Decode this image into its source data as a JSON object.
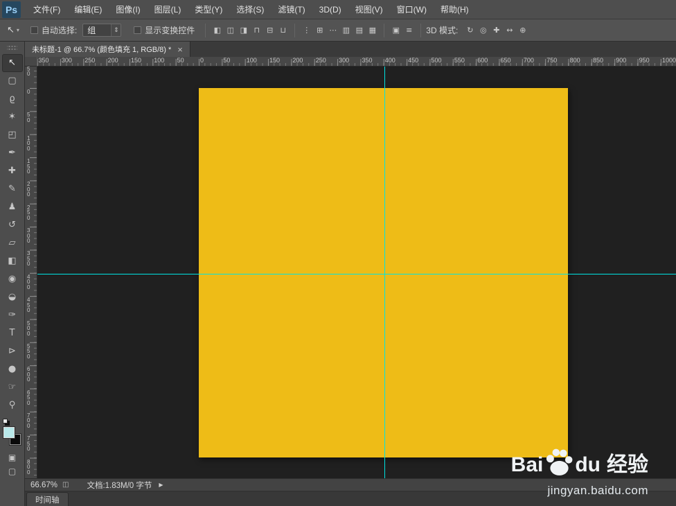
{
  "menu_bar": {
    "logo": "Ps",
    "items": [
      {
        "label": "文件(F)"
      },
      {
        "label": "编辑(E)"
      },
      {
        "label": "图像(I)"
      },
      {
        "label": "图层(L)"
      },
      {
        "label": "类型(Y)"
      },
      {
        "label": "选择(S)"
      },
      {
        "label": "滤镜(T)"
      },
      {
        "label": "3D(D)"
      },
      {
        "label": "视图(V)"
      },
      {
        "label": "窗口(W)"
      },
      {
        "label": "帮助(H)"
      }
    ]
  },
  "options_bar": {
    "tool_icon": "↖",
    "dropdown_arrow": "▾",
    "auto_select_label": "自动选择:",
    "group_value": "组",
    "stepper_glyph": "⇕",
    "show_transform_label": "显示变换控件",
    "align_icons": [
      {
        "name": "align-left-edges-icon",
        "glyph": "◧"
      },
      {
        "name": "align-horizontal-centers-icon",
        "glyph": "◫"
      },
      {
        "name": "align-right-edges-icon",
        "glyph": "◨"
      },
      {
        "name": "align-top-edges-icon",
        "glyph": "⊓"
      },
      {
        "name": "align-vertical-centers-icon",
        "glyph": "⊟"
      },
      {
        "name": "align-bottom-edges-icon",
        "glyph": "⊔"
      }
    ],
    "distribute_icons": [
      {
        "name": "distribute-top-edges-icon",
        "glyph": "⋮"
      },
      {
        "name": "distribute-vertical-centers-icon",
        "glyph": "⊞"
      },
      {
        "name": "distribute-bottom-edges-icon",
        "glyph": "⋯"
      },
      {
        "name": "distribute-left-edges-icon",
        "glyph": "▥"
      },
      {
        "name": "distribute-horizontal-centers-icon",
        "glyph": "▤"
      },
      {
        "name": "distribute-right-edges-icon",
        "glyph": "▦"
      }
    ],
    "extra_icons": [
      {
        "name": "auto-align-layers-icon",
        "glyph": "▣"
      },
      {
        "name": "arrange-icon",
        "glyph": "≡"
      }
    ],
    "mode_3d_label": "3D 模式:",
    "mode_3d_icons": [
      {
        "name": "3d-rotate-icon",
        "glyph": "↻"
      },
      {
        "name": "3d-roll-icon",
        "glyph": "◎"
      },
      {
        "name": "3d-drag-icon",
        "glyph": "✚"
      },
      {
        "name": "3d-slide-icon",
        "glyph": "↔"
      },
      {
        "name": "3d-scale-icon",
        "glyph": "⊕"
      }
    ]
  },
  "document_tab": {
    "title": "未标题-1 @ 66.7% (颜色填充 1, RGB/8) *",
    "close_glyph": "×"
  },
  "tools": [
    {
      "name": "move-tool",
      "glyph": "↖"
    },
    {
      "name": "rectangular-marquee-tool",
      "glyph": "▢"
    },
    {
      "name": "lasso-tool",
      "glyph": "ϱ"
    },
    {
      "name": "quick-selection-tool",
      "glyph": "✶"
    },
    {
      "name": "crop-tool",
      "glyph": "◰"
    },
    {
      "name": "eyedropper-tool",
      "glyph": "✒"
    },
    {
      "name": "healing-brush-tool",
      "glyph": "✚"
    },
    {
      "name": "brush-tool",
      "glyph": "✎"
    },
    {
      "name": "clone-stamp-tool",
      "glyph": "♟"
    },
    {
      "name": "history-brush-tool",
      "glyph": "↺"
    },
    {
      "name": "eraser-tool",
      "glyph": "▱"
    },
    {
      "name": "gradient-tool",
      "glyph": "◧"
    },
    {
      "name": "blur-tool",
      "glyph": "◉"
    },
    {
      "name": "dodge-tool",
      "glyph": "◒"
    },
    {
      "name": "pen-tool",
      "glyph": "✑"
    },
    {
      "name": "type-tool",
      "glyph": "T"
    },
    {
      "name": "path-selection-tool",
      "glyph": "⊳"
    },
    {
      "name": "shape-tool",
      "glyph": "●"
    },
    {
      "name": "hand-tool",
      "glyph": "☞"
    },
    {
      "name": "zoom-tool",
      "glyph": "⚲"
    }
  ],
  "tool_colors": {
    "foreground": "#b9e9ea",
    "background": "#0a0a0a"
  },
  "tool_footer": [
    {
      "name": "quick-mask-mode-icon",
      "glyph": "▣"
    },
    {
      "name": "screen-mode-icon",
      "glyph": "▢"
    }
  ],
  "rulers": {
    "horizontal": [
      "350",
      "300",
      "250",
      "200",
      "150",
      "100",
      "50",
      "0",
      "50",
      "100",
      "150",
      "200",
      "250",
      "300",
      "350",
      "400",
      "450",
      "500",
      "550",
      "600",
      "650",
      "700",
      "750",
      "800",
      "850",
      "900",
      "950",
      "1000"
    ],
    "vertical": [
      "50",
      "0",
      "50",
      "100",
      "150",
      "200",
      "250",
      "300",
      "350",
      "400",
      "450",
      "500",
      "550",
      "600",
      "650",
      "700",
      "750",
      "800"
    ]
  },
  "canvas": {
    "fill_color": "#eebc17",
    "guide_color": "#00e4e4",
    "background": "#202020"
  },
  "status_bar": {
    "zoom": "66.67%",
    "status_icon": "◫",
    "doc_info": "文档:1.83M/0 字节",
    "menu_arrow": "▶"
  },
  "timeline": {
    "label": "时间轴"
  },
  "watermark": {
    "brand_prefix": "Bai",
    "brand_suffix": "du",
    "brand_cn": "经验",
    "url": "jingyan.baidu.com"
  }
}
